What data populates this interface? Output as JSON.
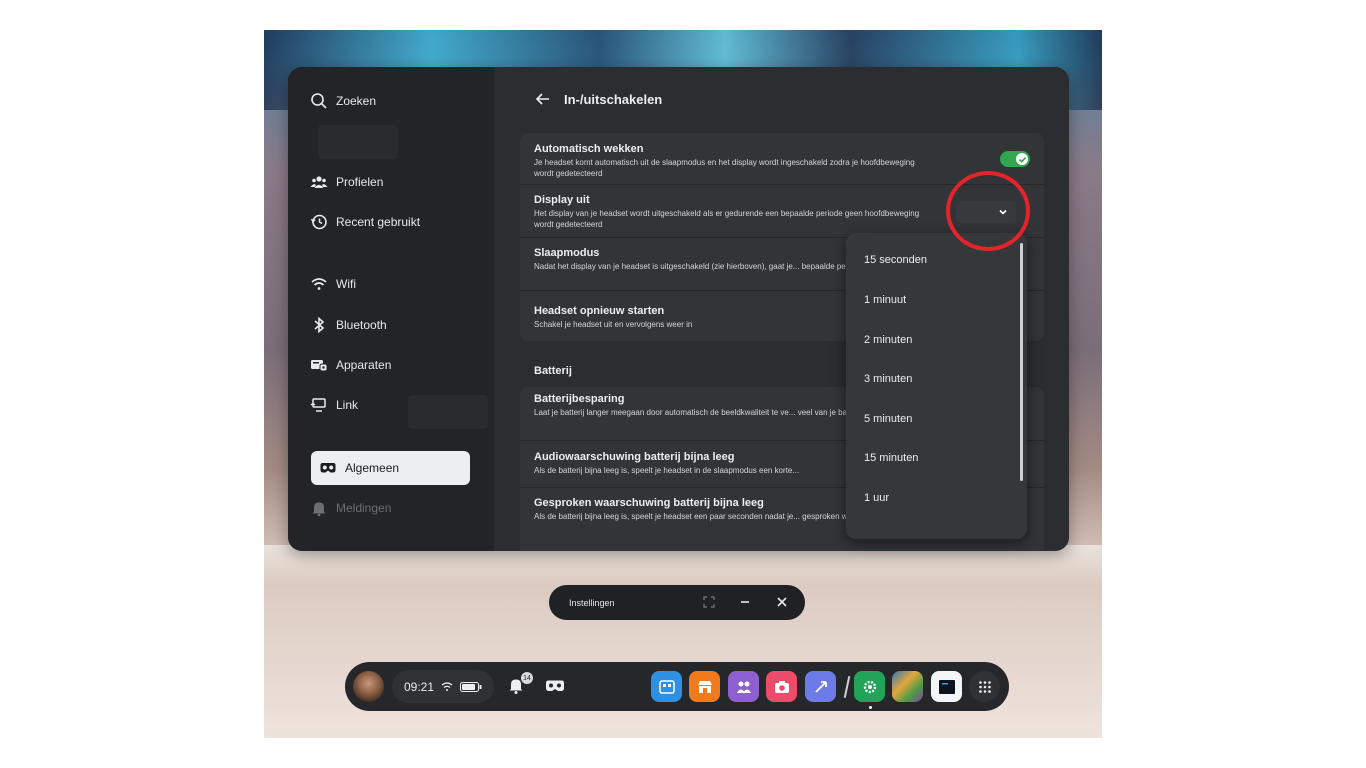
{
  "sidebar": {
    "search": "Zoeken",
    "items": [
      {
        "label": "Profielen"
      },
      {
        "label": "Recent gebruikt"
      },
      {
        "label": "Wifi"
      },
      {
        "label": "Bluetooth"
      },
      {
        "label": "Apparaten"
      },
      {
        "label": "Link"
      },
      {
        "label": "Algemeen"
      },
      {
        "label": "Meldingen"
      }
    ]
  },
  "header": {
    "title": "In-/uitschakelen"
  },
  "settings": [
    {
      "title": "Automatisch wekken",
      "desc": "Je headset komt automatisch uit de slaapmodus en het display wordt ingeschakeld zodra je hoofdbeweging wordt gedetecteerd",
      "toggle": true
    },
    {
      "title": "Display uit",
      "desc": "Het display van je headset wordt uitgeschakeld als er gedurende een bepaalde periode geen hoofdbeweging wordt gedetecteerd"
    },
    {
      "title": "Slaapmodus",
      "desc": "Nadat het display van je headset is uitgeschakeld (zie hierboven), gaat je... bepaalde periode in de slaapmodus"
    },
    {
      "title": "Headset opnieuw starten",
      "desc": "Schakel je headset uit en vervolgens weer in"
    }
  ],
  "battery": {
    "section": "Batterij",
    "items": [
      {
        "title": "Batterijbesparing",
        "desc": "Laat je batterij langer meegaan door automatisch de beeldkwaliteit te ve... veel van je batterij vragen"
      },
      {
        "title": "Audiowaarschuwing batterij bijna leeg",
        "desc": "Als de batterij bijna leeg is, speelt je headset in de slaapmodus een korte..."
      },
      {
        "title": "Gesproken waarschuwing batterij bijna leeg",
        "desc": "Als de batterij bijna leeg is, speelt je headset een paar seconden nadat je... gesproken waarschuwing af"
      }
    ]
  },
  "dropdown": {
    "options": [
      "15 seconden",
      "1 minuut",
      "2 minuten",
      "3 minuten",
      "5 minuten",
      "15 minuten",
      "1 uur"
    ]
  },
  "window_bar": {
    "label": "Instellingen"
  },
  "taskbar": {
    "time": "09:21",
    "notification_count": "14"
  },
  "colors": {
    "toggle_on": "#2fa84f",
    "highlight_circle": "#e52429",
    "active_item_bg": "#eceef1"
  }
}
